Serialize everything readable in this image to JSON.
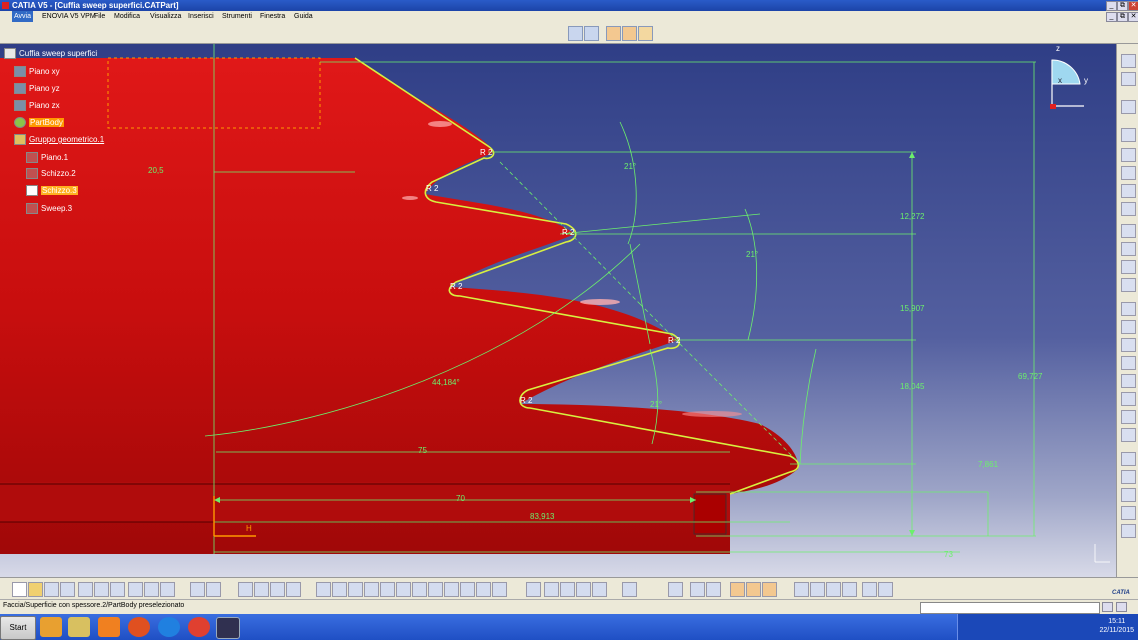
{
  "window": {
    "title": "CATIA V5 - [Cuffia sweep superfici.CATPart]",
    "controls": [
      "_",
      "⧉",
      "✕"
    ]
  },
  "menubar": {
    "items": [
      "Avvia",
      "ENOVIA V5 VPM",
      "File",
      "Modifica",
      "Visualizza",
      "Inserisci",
      "Strumenti",
      "Finestra",
      "Guida"
    ]
  },
  "tree": {
    "root": "Cuffia sweep superfici",
    "nodes": [
      {
        "label": "Piano xy",
        "icon": "plane-icon"
      },
      {
        "label": "Piano yz",
        "icon": "plane-icon"
      },
      {
        "label": "Piano zx",
        "icon": "plane-icon"
      },
      {
        "label": "PartBody",
        "icon": "gear-icon"
      },
      {
        "label": "Gruppo geometrico.1",
        "icon": "geometric-set-icon"
      },
      {
        "label": "Piano.1",
        "icon": "plane-icon"
      },
      {
        "label": "Schizzo.2",
        "icon": "sketch-icon"
      },
      {
        "label": "Schizzo.3",
        "icon": "sketch-icon"
      },
      {
        "label": "Sweep.3",
        "icon": "sweep-icon"
      }
    ]
  },
  "dimensions": {
    "d20_5": "20,5",
    "a21_top": "21°",
    "a21_mid": "21°",
    "a21_low": "21°",
    "r2_1": "R 2",
    "r2_2": "R 2",
    "r2_3": "R 2",
    "r2_4": "R 2",
    "r2_5": "R 2",
    "r2_6": "R 2",
    "d12_272": "12,272",
    "d15_907": "15,907",
    "d18_045": "18,045",
    "d69_727": "69,727",
    "d44_184": "44,184°",
    "d75": "75",
    "d70": "70",
    "d83_913": "83,913",
    "d7_861": "7,861",
    "d73": "73",
    "dH": "H"
  },
  "compass": {
    "x": "x",
    "y": "y",
    "z": "z"
  },
  "statusbar": {
    "text": "Faccia/Superficie con spessore.2/PartBody preselezionato"
  },
  "taskbar": {
    "start": "Start",
    "time": "15:11",
    "date": "22/11/2015"
  },
  "brand": {
    "catia": "CATIA"
  },
  "colors": {
    "part_red": "#d41414",
    "constraint_green": "#6cf06c",
    "selection_orange": "#ff9900"
  }
}
